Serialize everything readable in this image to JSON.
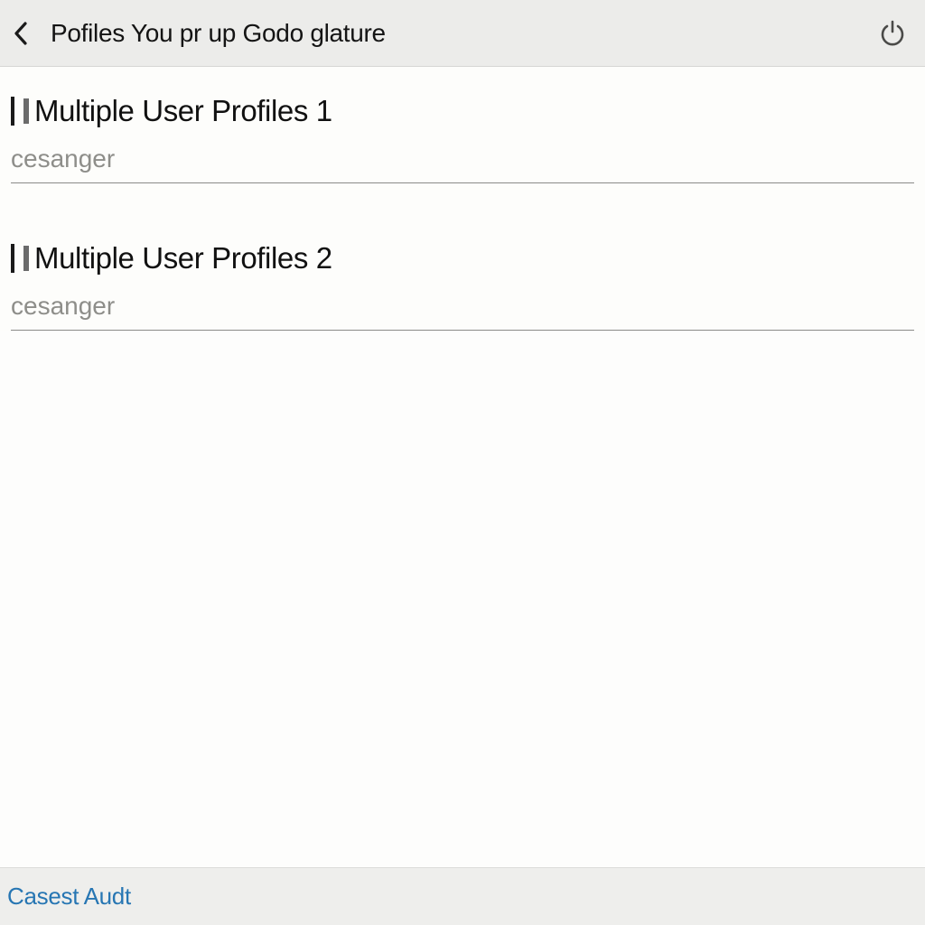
{
  "header": {
    "title": "Pofiles You pr up Godo glature"
  },
  "profiles": [
    {
      "title": "Multiple User Profiles 1",
      "value": "cesanger"
    },
    {
      "title": "Multiple User Profiles 2",
      "value": "cesanger"
    }
  ],
  "footer": {
    "link": "Casest Audt"
  }
}
